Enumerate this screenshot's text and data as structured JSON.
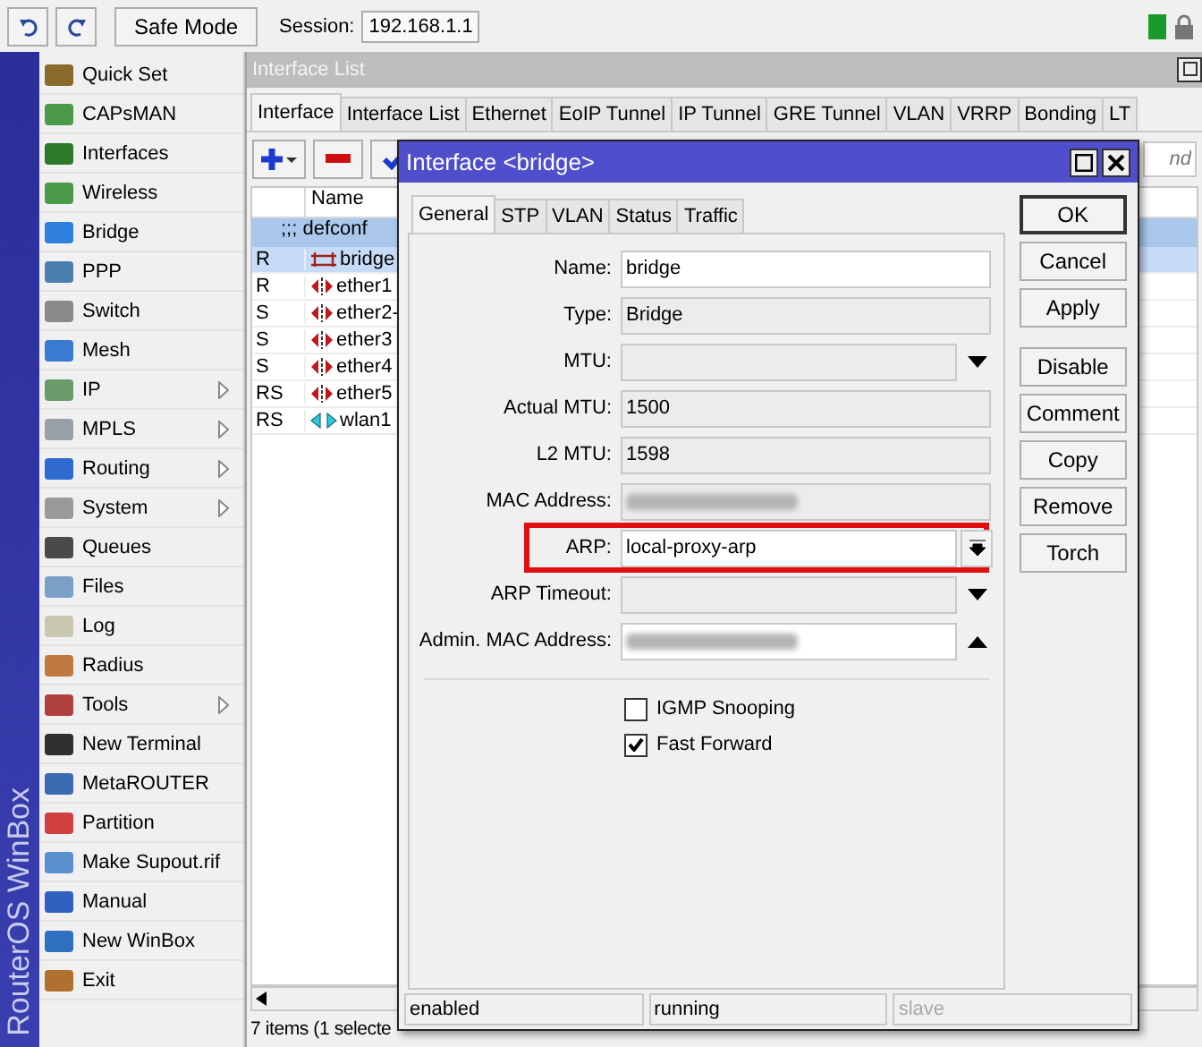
{
  "toolbar": {
    "safe_mode": "Safe Mode",
    "session_label": "Session:",
    "session_value": "192.168.1.1"
  },
  "brand": "RouterOS WinBox",
  "sidebar": {
    "items": [
      {
        "label": "Quick Set",
        "submenu": false
      },
      {
        "label": "CAPsMAN",
        "submenu": false
      },
      {
        "label": "Interfaces",
        "submenu": false
      },
      {
        "label": "Wireless",
        "submenu": false
      },
      {
        "label": "Bridge",
        "submenu": false
      },
      {
        "label": "PPP",
        "submenu": false
      },
      {
        "label": "Switch",
        "submenu": false
      },
      {
        "label": "Mesh",
        "submenu": false
      },
      {
        "label": "IP",
        "submenu": true
      },
      {
        "label": "MPLS",
        "submenu": true
      },
      {
        "label": "Routing",
        "submenu": true
      },
      {
        "label": "System",
        "submenu": true
      },
      {
        "label": "Queues",
        "submenu": false
      },
      {
        "label": "Files",
        "submenu": false
      },
      {
        "label": "Log",
        "submenu": false
      },
      {
        "label": "Radius",
        "submenu": false
      },
      {
        "label": "Tools",
        "submenu": true
      },
      {
        "label": "New Terminal",
        "submenu": false
      },
      {
        "label": "MetaROUTER",
        "submenu": false
      },
      {
        "label": "Partition",
        "submenu": false
      },
      {
        "label": "Make Supout.rif",
        "submenu": false
      },
      {
        "label": "Manual",
        "submenu": false
      },
      {
        "label": "New WinBox",
        "submenu": false
      },
      {
        "label": "Exit",
        "submenu": false
      }
    ]
  },
  "interface_list": {
    "title": "Interface List",
    "tabs": [
      {
        "label": "Interface",
        "selected": true
      },
      {
        "label": "Interface List",
        "selected": false
      },
      {
        "label": "Ethernet",
        "selected": false
      },
      {
        "label": "EoIP Tunnel",
        "selected": false
      },
      {
        "label": "IP Tunnel",
        "selected": false
      },
      {
        "label": "GRE Tunnel",
        "selected": false
      },
      {
        "label": "VLAN",
        "selected": false
      },
      {
        "label": "VRRP",
        "selected": false
      },
      {
        "label": "Bonding",
        "selected": false
      },
      {
        "label": "LT",
        "selected": false
      }
    ],
    "find_placeholder": "nd",
    "columns": [
      "Name"
    ],
    "group": ";;; defconf",
    "rows": [
      {
        "flags": "R",
        "name": "bridge",
        "kind": "bridge",
        "selected": true
      },
      {
        "flags": "R",
        "name": "ether1",
        "kind": "ethernet",
        "selected": false
      },
      {
        "flags": "S",
        "name": "ether2-",
        "kind": "ethernet",
        "selected": false
      },
      {
        "flags": "S",
        "name": "ether3",
        "kind": "ethernet",
        "selected": false
      },
      {
        "flags": "S",
        "name": "ether4",
        "kind": "ethernet",
        "selected": false
      },
      {
        "flags": "RS",
        "name": "ether5",
        "kind": "ethernet",
        "selected": false
      },
      {
        "flags": "RS",
        "name": "wlan1",
        "kind": "wireless",
        "selected": false
      }
    ],
    "status": "7 items (1 selecte"
  },
  "dialog": {
    "title": "Interface <bridge>",
    "tabs": [
      {
        "label": "General",
        "selected": true
      },
      {
        "label": "STP",
        "selected": false
      },
      {
        "label": "VLAN",
        "selected": false
      },
      {
        "label": "Status",
        "selected": false
      },
      {
        "label": "Traffic",
        "selected": false
      }
    ],
    "fields": [
      {
        "kind": "plain",
        "label": "Name:",
        "value": "bridge",
        "editable": true,
        "blurred": false,
        "highlighted": false
      },
      {
        "kind": "plain",
        "label": "Type:",
        "value": "Bridge",
        "editable": false,
        "blurred": false,
        "highlighted": false
      },
      {
        "kind": "down",
        "label": "MTU:",
        "editable": false,
        "blurred": false,
        "highlighted": false
      },
      {
        "kind": "plain",
        "label": "Actual MTU:",
        "value": "1500",
        "editable": false,
        "blurred": false,
        "highlighted": false
      },
      {
        "kind": "plain",
        "label": "L2 MTU:",
        "value": "1598",
        "editable": false,
        "blurred": false,
        "highlighted": false
      },
      {
        "kind": "plain",
        "label": "MAC Address:",
        "editable": false,
        "blurred": true,
        "highlighted": false
      },
      {
        "kind": "dropdown",
        "label": "ARP:",
        "value": "local-proxy-arp",
        "editable": true,
        "blurred": false,
        "highlighted": true
      },
      {
        "kind": "down",
        "label": "ARP Timeout:",
        "editable": false,
        "blurred": false,
        "highlighted": false
      },
      {
        "kind": "up",
        "label": "Admin. MAC Address:",
        "editable": true,
        "blurred": true,
        "highlighted": false
      }
    ],
    "checkboxes": [
      {
        "label": "IGMP Snooping",
        "checked": false
      },
      {
        "label": "Fast Forward",
        "checked": true
      }
    ],
    "button_groups": [
      [
        {
          "label": "OK",
          "default": true
        },
        {
          "label": "Cancel",
          "default": false
        },
        {
          "label": "Apply",
          "default": false
        }
      ],
      [
        {
          "label": "Disable",
          "default": false
        },
        {
          "label": "Comment",
          "default": false
        },
        {
          "label": "Copy",
          "default": false
        },
        {
          "label": "Remove",
          "default": false
        },
        {
          "label": "Torch",
          "default": false
        }
      ]
    ],
    "status": [
      {
        "text": "enabled",
        "disabled": false
      },
      {
        "text": "running",
        "disabled": false
      },
      {
        "text": "slave",
        "disabled": true
      }
    ]
  }
}
